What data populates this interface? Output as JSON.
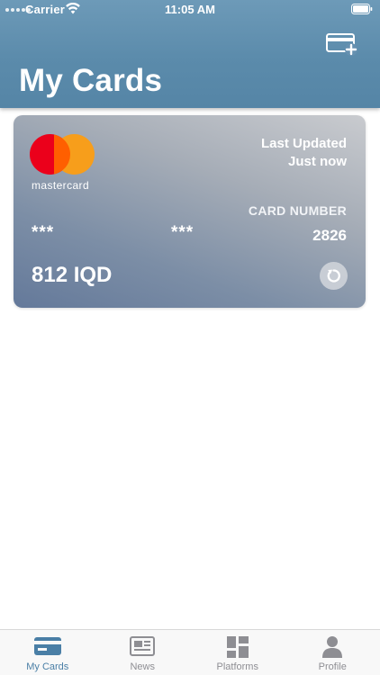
{
  "status_bar": {
    "carrier": "Carrier",
    "time": "11:05 AM"
  },
  "header": {
    "title": "My Cards",
    "add_card_icon": "add-card-icon"
  },
  "card": {
    "brand": "mastercard",
    "last_updated_label": "Last Updated",
    "last_updated_value": "Just now",
    "card_number_label": "CARD NUMBER",
    "masked_group_1": "***",
    "masked_group_2": "***",
    "last_four": "2826",
    "balance": "812 IQD",
    "refresh_icon": "refresh-icon"
  },
  "tabs": [
    {
      "label": "My Cards",
      "icon": "card-icon",
      "active": true
    },
    {
      "label": "News",
      "icon": "newspaper-icon",
      "active": false
    },
    {
      "label": "Platforms",
      "icon": "grid-icon",
      "active": false
    },
    {
      "label": "Profile",
      "icon": "person-icon",
      "active": false
    }
  ],
  "colors": {
    "header": "#5b8bab",
    "active_tab": "#4a7fa6",
    "inactive_tab": "#8e8e93",
    "mastercard_red": "#eb001b",
    "mastercard_yellow": "#f79e1b"
  }
}
